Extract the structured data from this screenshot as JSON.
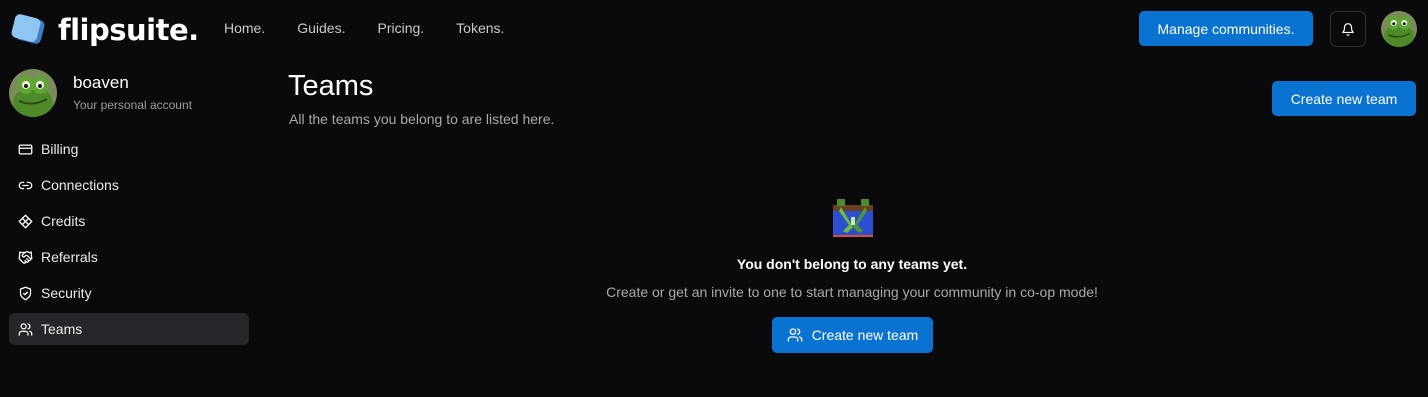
{
  "app": {
    "name": "flipsuite."
  },
  "nav": [
    {
      "label": "Home."
    },
    {
      "label": "Guides."
    },
    {
      "label": "Pricing."
    },
    {
      "label": "Tokens."
    }
  ],
  "header": {
    "manage_label": "Manage communities.",
    "notifications_icon": "bell-icon",
    "avatar_icon": "user-avatar"
  },
  "profile": {
    "username": "boaven",
    "subtitle": "Your personal account"
  },
  "sidebar": {
    "items": [
      {
        "label": "Billing",
        "icon": "credit-card-icon"
      },
      {
        "label": "Connections",
        "icon": "link-icon"
      },
      {
        "label": "Credits",
        "icon": "diamond-icon"
      },
      {
        "label": "Referrals",
        "icon": "handshake-icon"
      },
      {
        "label": "Security",
        "icon": "shield-icon"
      },
      {
        "label": "Teams",
        "icon": "users-icon",
        "active": true
      }
    ]
  },
  "main": {
    "title": "Teams",
    "subtitle": "All the teams you belong to are listed here.",
    "create_label": "Create new team",
    "empty": {
      "title": "You don't belong to any teams yet.",
      "subtitle": "Create or get an invite to one to start managing your community in co-op mode!",
      "button_label": "Create new team"
    }
  },
  "colors": {
    "background": "#0a0a0c",
    "accent": "#0a72d0",
    "active_item": "#26262a"
  }
}
